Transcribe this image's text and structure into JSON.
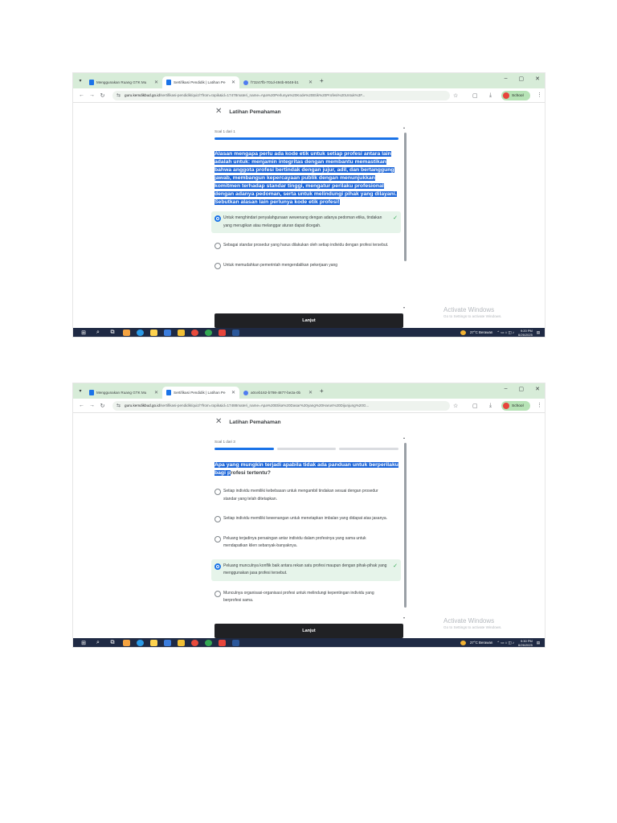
{
  "browser": {
    "tabs": [
      {
        "title": "Menggunakan Ruang GTK Mu",
        "icon": "doc-icon",
        "active": false
      },
      {
        "title": "Sertifikasi Pendidik | Latihan Pe",
        "icon": "doc-icon",
        "active": true
      },
      {
        "title": "f73247fb-701d-494b-9048-b1",
        "icon": "globe-icon",
        "active": false
      }
    ],
    "window_controls": [
      "–",
      "▢",
      "✕"
    ],
    "profile_label": "School"
  },
  "shots": [
    {
      "tab3_title": "f73247fb-701d-494b-9048-b1",
      "url_host": "guru.kemdikbud.go.id",
      "url_path": "/sertifikasi-pendidik/quiz/7from=topik&id=17478materi_name=Apa%20Perlunya%20Kode%20Etik%20Profesi%20Untuk%3F...",
      "panel_title": "Latihan Pemahaman",
      "counter": "Soal 1 dari 1",
      "progress": {
        "total": 1,
        "done": 1
      },
      "question": "Alasan mengapa perlu ada kode etik untuk setiap profesi antara lain adalah untuk: menjamin integritas dengan membantu memastikan bahwa anggota profesi bertindak dengan jujur, adil, dan bertanggung jawab, membangun kepercayaan publik dengan menunjukkan komitmen terhadap standar tinggi, mengatur perilaku profesional dengan adanya pedoman, serta untuk melindungi pihak yang dilayani. Sebutkan alasan lain perlunya kode etik profesi!",
      "options": [
        {
          "text": "Untuk menghindari penyalahgunaan wewenang dengan adanya pedoman etika, tindakan yang merugikan atau melanggar aturan dapat dicegah.",
          "selected": true
        },
        {
          "text": "Sebagai standar prosedur yang harus dilakukan oleh setiap individu dengan profesi tersebut.",
          "selected": false
        },
        {
          "text": "Untuk memudahkan pemerintah mengendalikan pekerjaan yang",
          "selected": false
        }
      ],
      "next_label": "Lanjut",
      "activate_title": "Activate Windows",
      "activate_sub": "Go to Settings to activate Windows.",
      "weather": "27°C Berawan",
      "time": "9:20 PM",
      "date": "6/26/2025"
    },
    {
      "tab3_title": "a0ceb162-b798-4877-be2a-0b",
      "url_host": "guru.kemdikbud.go.id",
      "url_path": "/sertifikasi-pendidik/quiz/?from=topik&id=17488materi_name=Apa%20Etika%20Dasar%20yang%20Harus%20Dijunjung%20G...",
      "panel_title": "Latihan Pemahaman",
      "counter": "Soal 1 dari 3",
      "progress": {
        "total": 3,
        "done": 1
      },
      "question_highlighted": "Apa yang mungkin terjadi apabila tidak ada panduan untuk berperilaku bagi p",
      "question_rest": "rofesi tertentu?",
      "options": [
        {
          "text": "Setiap individu memiliki kebebasan untuk mengambil tindakan sesuai dengan prosedur standar yang telah ditetapkan.",
          "selected": false
        },
        {
          "text": "Setiap individu memiliki kewenangan untuk menetapkan imbalan yang didapat atas jasanya.",
          "selected": false
        },
        {
          "text": "Peluang terjadinya persaingan antar individu dalam profesinya yang sama untuk mendapatkan klien sebanyak-banyaknya.",
          "selected": false
        },
        {
          "text": "Peluang munculnya konflik baik antara rekan satu profesi maupun dengan pihak-pihak yang menggunakan jasa profesi tersebut.",
          "selected": true
        },
        {
          "text": "Munculnya organisasi-organisasi profesi untuk melindungi kepentingan individu yang berprofesi sama.",
          "selected": false
        }
      ],
      "next_label": "Lanjut",
      "activate_title": "Activate Windows",
      "activate_sub": "Go to Settings to activate Windows.",
      "weather": "27°C Berawan",
      "time": "9:30 PM",
      "date": "6/26/2025"
    }
  ],
  "colors": {
    "accent": "#1a73e8",
    "selected_bg": "#e6f4ea",
    "check": "#34a853",
    "button": "#202124",
    "tabstrip": "#d7ecd8",
    "taskbar": "#1f2a44"
  }
}
